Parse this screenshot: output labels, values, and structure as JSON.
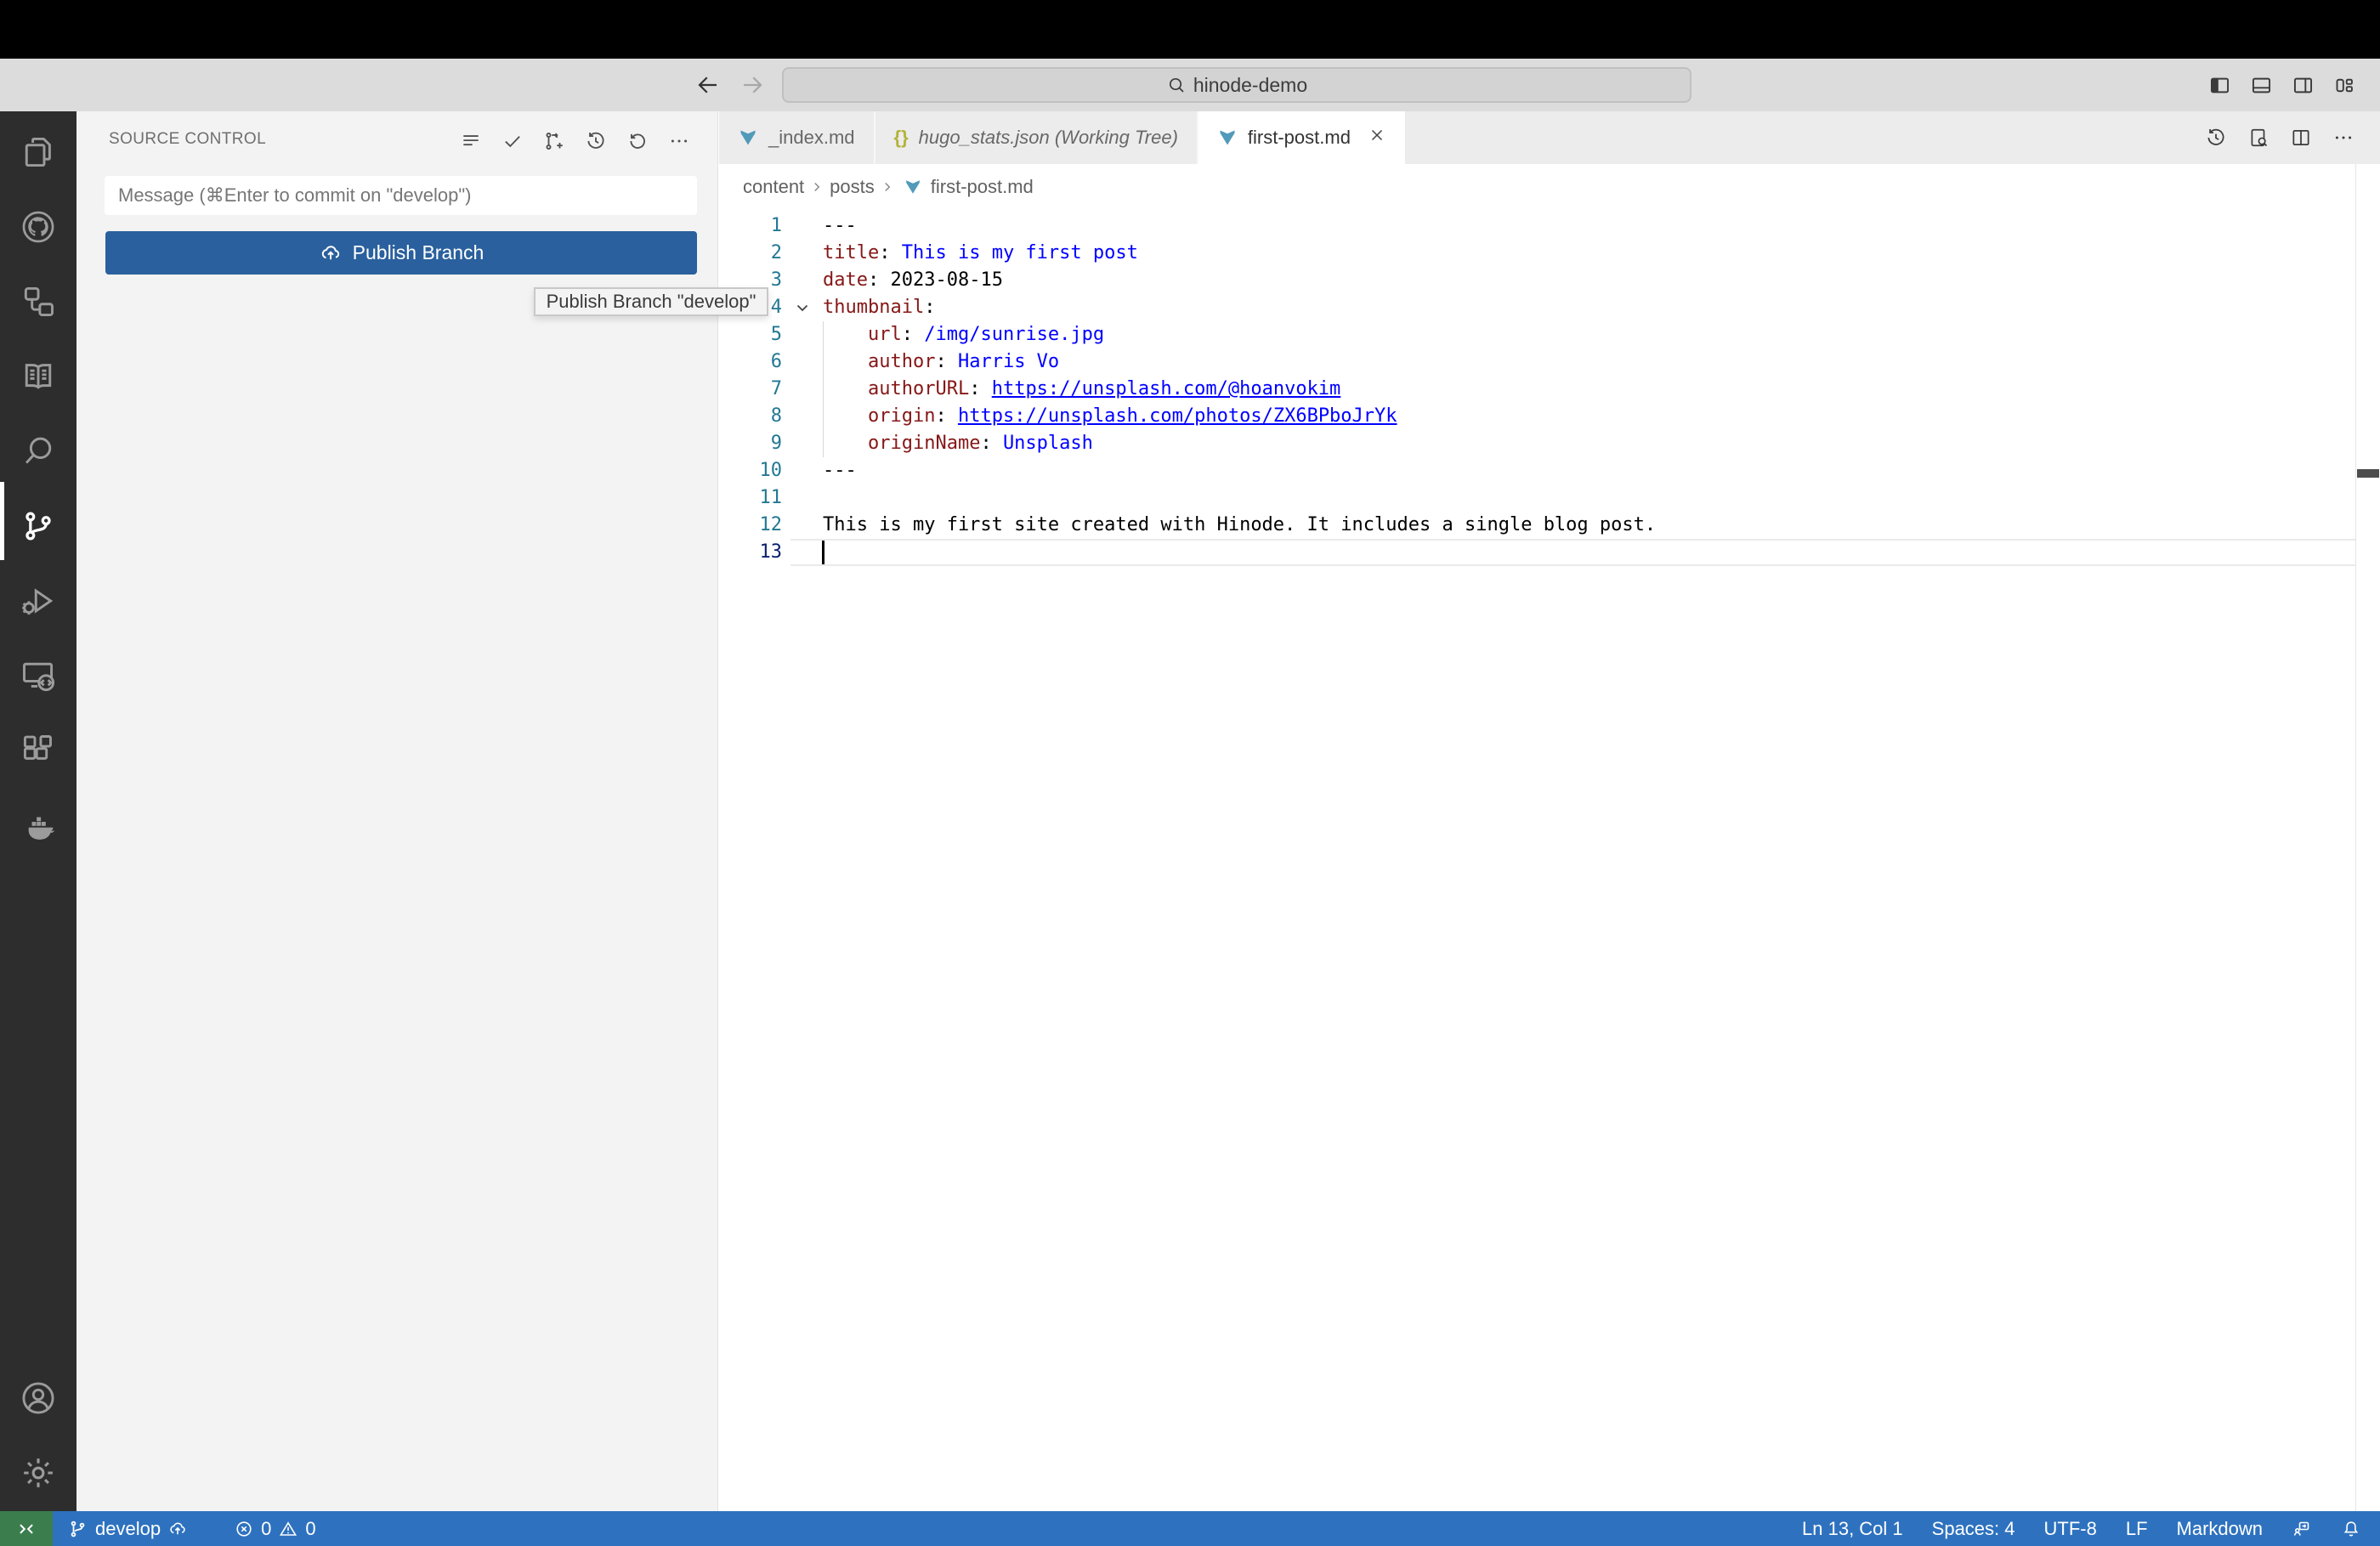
{
  "colors": {
    "accent-button": "#2a609d",
    "status-bar": "#2e72bf",
    "remote-green": "#3c7d4e",
    "activity-bar": "#2d2d2d",
    "title-bar": "#dcdcdc",
    "sidebar-bg": "#f3f3f3",
    "tab-bar": "#ececec",
    "yaml-key": "#861717",
    "yaml-val": "#0000ff",
    "md-icon-blue": "#519aba",
    "json-icon-yellow": "#b3b33b"
  },
  "title_bar": {
    "command_center": "hinode-demo"
  },
  "source_control": {
    "header": "SOURCE CONTROL",
    "message_placeholder": "Message (⌘Enter to commit on \"develop\")",
    "publish_button": "Publish Branch",
    "tooltip": "Publish Branch \"develop\""
  },
  "editor": {
    "tabs": [
      {
        "label": "_index.md",
        "icon": "markdown"
      },
      {
        "label": "hugo_stats.json (Working Tree)",
        "icon": "json",
        "preview": true
      },
      {
        "label": "first-post.md",
        "icon": "markdown",
        "active": true
      }
    ],
    "breadcrumb": {
      "items": [
        "content",
        "posts",
        "first-post.md"
      ]
    },
    "lines": [
      {
        "num": 1,
        "tokens": [
          [
            "plain",
            "---"
          ]
        ]
      },
      {
        "num": 2,
        "tokens": [
          [
            "key",
            "title"
          ],
          [
            "plain",
            ": "
          ],
          [
            "val",
            "This is my first post"
          ]
        ]
      },
      {
        "num": 3,
        "tokens": [
          [
            "key",
            "date"
          ],
          [
            "plain",
            ": "
          ],
          [
            "plain",
            "2023-08-15"
          ]
        ]
      },
      {
        "num": 4,
        "tokens": [
          [
            "key",
            "thumbnail"
          ],
          [
            "plain",
            ":"
          ]
        ],
        "fold": true
      },
      {
        "num": 5,
        "tokens": [
          [
            "plain",
            "    "
          ],
          [
            "key",
            "url"
          ],
          [
            "plain",
            ": "
          ],
          [
            "val",
            "/img/sunrise.jpg"
          ]
        ]
      },
      {
        "num": 6,
        "tokens": [
          [
            "plain",
            "    "
          ],
          [
            "key",
            "author"
          ],
          [
            "plain",
            ": "
          ],
          [
            "val",
            "Harris Vo"
          ]
        ]
      },
      {
        "num": 7,
        "tokens": [
          [
            "plain",
            "    "
          ],
          [
            "key",
            "authorURL"
          ],
          [
            "plain",
            ": "
          ],
          [
            "link",
            "https://unsplash.com/@hoanvokim"
          ]
        ]
      },
      {
        "num": 8,
        "tokens": [
          [
            "plain",
            "    "
          ],
          [
            "key",
            "origin"
          ],
          [
            "plain",
            ": "
          ],
          [
            "link",
            "https://unsplash.com/photos/ZX6BPboJrYk"
          ]
        ]
      },
      {
        "num": 9,
        "tokens": [
          [
            "plain",
            "    "
          ],
          [
            "key",
            "originName"
          ],
          [
            "plain",
            ": "
          ],
          [
            "val",
            "Unsplash"
          ]
        ]
      },
      {
        "num": 10,
        "tokens": [
          [
            "plain",
            "---"
          ]
        ]
      },
      {
        "num": 11,
        "tokens": []
      },
      {
        "num": 12,
        "tokens": [
          [
            "plain",
            "This is my first site created with Hinode. It includes a single blog post."
          ]
        ]
      },
      {
        "num": 13,
        "tokens": [],
        "cursor": true,
        "active": true
      }
    ]
  },
  "status_bar": {
    "branch": "develop",
    "errors": "0",
    "warnings": "0",
    "line_col": "Ln 13, Col 1",
    "spaces": "Spaces: 4",
    "encoding": "UTF-8",
    "eol": "LF",
    "language": "Markdown"
  }
}
